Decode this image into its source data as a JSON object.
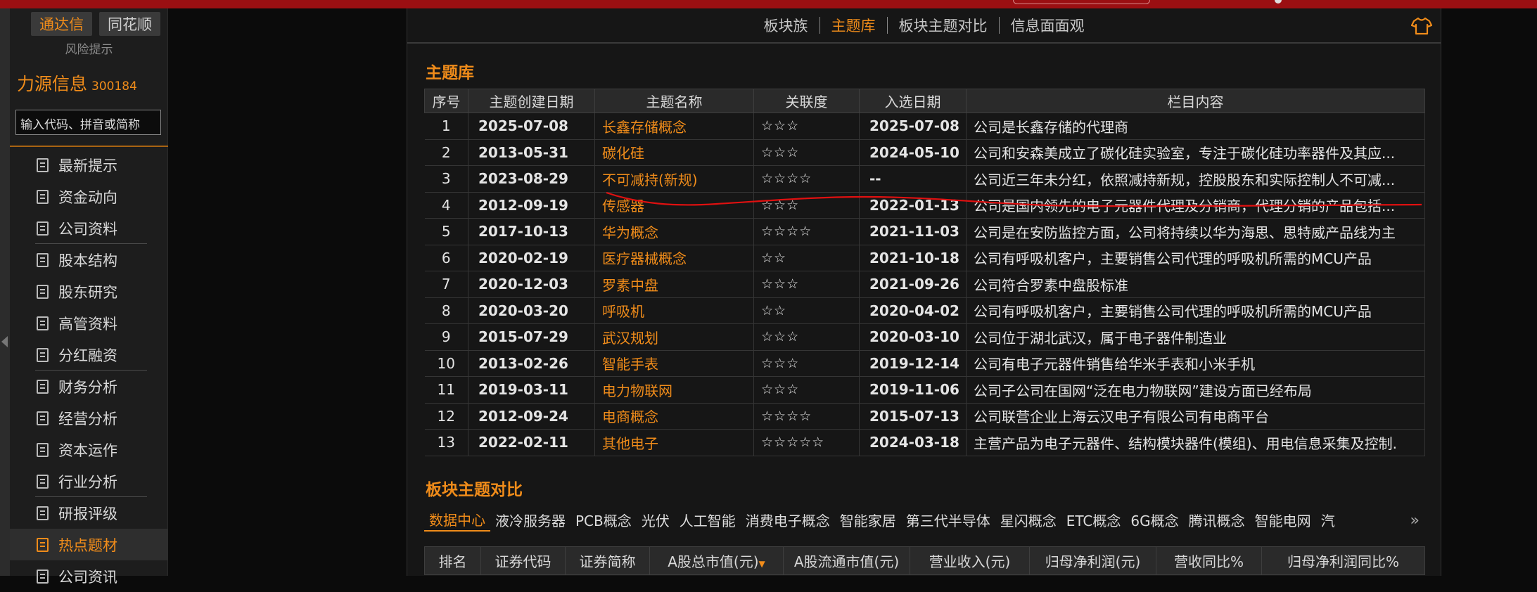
{
  "sidebar": {
    "tabs": [
      "通达信",
      "同花顺"
    ],
    "risk": "风险提示",
    "company_name": "力源信息",
    "company_code": "300184",
    "search_placeholder": "输入代码、拼音或简称",
    "menu": [
      "最新提示",
      "资金动向",
      "公司资料",
      "股本结构",
      "股东研究",
      "高管资料",
      "分红融资",
      "财务分析",
      "经营分析",
      "资本运作",
      "行业分析",
      "研报评级",
      "热点题材",
      "公司资讯"
    ],
    "active_item": "热点题材"
  },
  "nav": {
    "items": [
      "板块族",
      "主题库",
      "板块主题对比",
      "信息面面观"
    ],
    "active": "主题库",
    "right_icon": "shirt-icon"
  },
  "theme_lib": {
    "title": "主题库",
    "headers": [
      "序号",
      "主题创建日期",
      "主题名称",
      "关联度",
      "入选日期",
      "栏目内容"
    ],
    "rows": [
      {
        "no": "1",
        "created": "2025-07-08",
        "name": "长鑫存储概念",
        "stars": "☆☆☆",
        "selected": "2025-07-08",
        "content": "公司是长鑫存储的代理商"
      },
      {
        "no": "2",
        "created": "2013-05-31",
        "name": "碳化硅",
        "stars": "☆☆☆",
        "selected": "2024-05-10",
        "content": "公司和安森美成立了碳化硅实验室，专注于碳化硅功率器件及其应..."
      },
      {
        "no": "3",
        "created": "2023-08-29",
        "name": "不可减持(新规)",
        "stars": "☆☆☆☆",
        "selected": "--",
        "content": "公司近三年未分红，依照减持新规，控股股东和实际控制人不可减..."
      },
      {
        "no": "4",
        "created": "2012-09-19",
        "name": "传感器",
        "stars": "☆☆☆",
        "selected": "2022-01-13",
        "content": "公司是国内领先的电子元器件代理及分销商，代理分销的产品包括..."
      },
      {
        "no": "5",
        "created": "2017-10-13",
        "name": "华为概念",
        "stars": "☆☆☆☆",
        "selected": "2021-11-03",
        "content": "公司是在安防监控方面，公司将持续以华为海思、思特威产品线为主"
      },
      {
        "no": "6",
        "created": "2020-02-19",
        "name": "医疗器械概念",
        "stars": "☆☆",
        "selected": "2021-10-18",
        "content": "公司有呼吸机客户，主要销售公司代理的呼吸机所需的MCU产品"
      },
      {
        "no": "7",
        "created": "2020-12-03",
        "name": "罗素中盘",
        "stars": "☆☆☆",
        "selected": "2021-09-26",
        "content": "公司符合罗素中盘股标准"
      },
      {
        "no": "8",
        "created": "2020-03-20",
        "name": "呼吸机",
        "stars": "☆☆",
        "selected": "2020-04-02",
        "content": "公司有呼吸机客户，主要销售公司代理的呼吸机所需的MCU产品"
      },
      {
        "no": "9",
        "created": "2015-07-29",
        "name": "武汉规划",
        "stars": "☆☆☆",
        "selected": "2020-03-10",
        "content": "公司位于湖北武汉，属于电子器件制造业"
      },
      {
        "no": "10",
        "created": "2013-02-26",
        "name": "智能手表",
        "stars": "☆☆☆",
        "selected": "2019-12-14",
        "content": "公司有电子元器件销售给华米手表和小米手机"
      },
      {
        "no": "11",
        "created": "2019-03-11",
        "name": "电力物联网",
        "stars": "☆☆☆",
        "selected": "2019-11-06",
        "content": "公司子公司在国网“泛在电力物联网”建设方面已经布局"
      },
      {
        "no": "12",
        "created": "2012-09-24",
        "name": "电商概念",
        "stars": "☆☆☆☆",
        "selected": "2015-07-13",
        "content": "公司联营企业上海云汉电子有限公司有电商平台"
      },
      {
        "no": "13",
        "created": "2022-02-11",
        "name": "其他电子",
        "stars": "☆☆☆☆☆",
        "selected": "2024-03-18",
        "content": "主营产品为电子元器件、结构模块器件(模组)、用电信息采集及控制."
      }
    ]
  },
  "compare": {
    "title": "板块主题对比",
    "tabs": [
      "数据中心",
      "液冷服务器",
      "PCB概念",
      "光伏",
      "人工智能",
      "消费电子概念",
      "智能家居",
      "第三代半导体",
      "星闪概念",
      "ETC概念",
      "6G概念",
      "腾讯概念",
      "智能电网",
      "汽"
    ],
    "active_tab": "数据中心",
    "more": "»",
    "headers": [
      "排名",
      "证券代码",
      "证券简称",
      "A股总市值(元)",
      "A股流通市值(元)",
      "营业收入(元)",
      "归母净利润(元)",
      "营收同比%",
      "归母净利润同比%"
    ]
  }
}
